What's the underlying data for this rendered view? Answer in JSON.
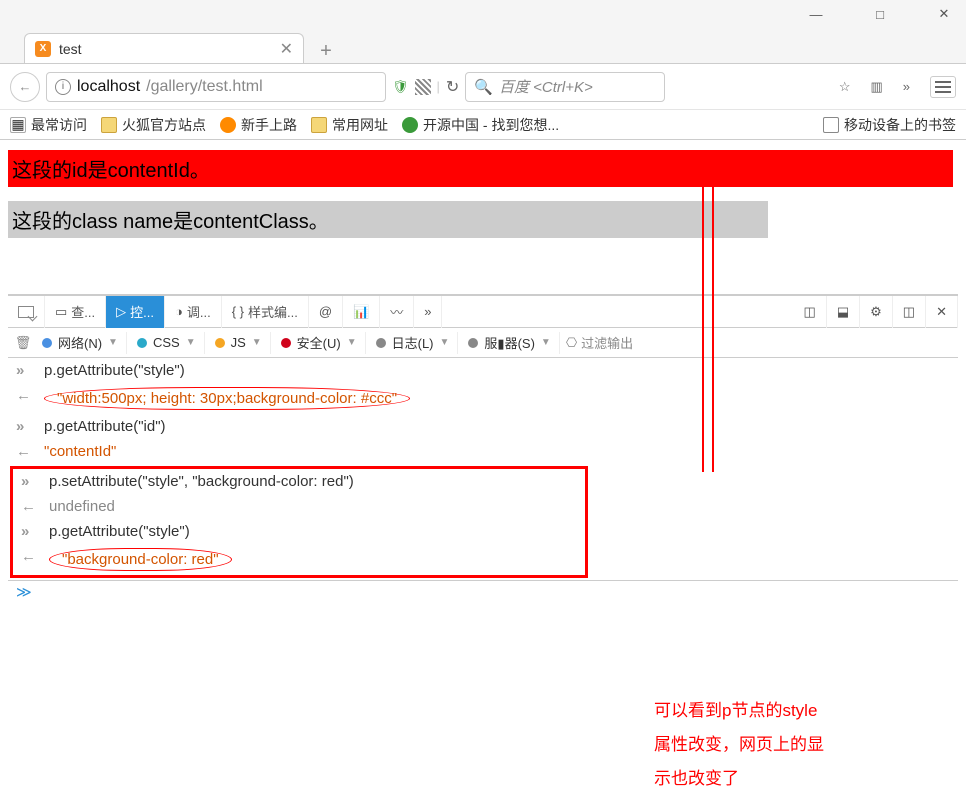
{
  "window": {
    "minimize": "—",
    "maximize": "□",
    "close": "✕"
  },
  "tab": {
    "icon_text": "X",
    "title": "test",
    "close": "✕",
    "newtab": "+"
  },
  "addr": {
    "back": "←",
    "info": "i",
    "host": "localhost",
    "path": "/gallery/test.html",
    "shield": "🛡",
    "refresh": "↻",
    "search_icon": "🔍",
    "search_placeholder": "百度 <Ctrl+K>",
    "star": "☆",
    "library": "▥",
    "more": "»"
  },
  "bookmarks": {
    "items": [
      {
        "label": "最常访问",
        "icon": "blue"
      },
      {
        "label": "火狐官方站点",
        "icon": "folder"
      },
      {
        "label": "新手上路",
        "icon": "ff"
      },
      {
        "label": "常用网址",
        "icon": "folder"
      },
      {
        "label": "开源中国 - 找到您想...",
        "icon": "green"
      }
    ],
    "right": {
      "label": "移动设备上的书签",
      "icon": "phone"
    }
  },
  "page": {
    "p1": "这段的id是contentId。",
    "p2": "这段的class name是contentClass。"
  },
  "devtools": {
    "tabs": {
      "inspector": "查...",
      "console": "控...",
      "debugger": "调...",
      "style": "样式编...",
      "at": "@",
      "more": "»"
    },
    "filters": {
      "net": "网络(N)",
      "css": "CSS",
      "js": "JS",
      "sec": "安全(U)",
      "log": "日志(L)",
      "server": "服▮器(S)",
      "filter_placeholder": "过滤输出"
    },
    "lines": [
      {
        "t": "in",
        "text": "p.getAttribute(\"style\")"
      },
      {
        "t": "out",
        "text": "\"width:500px; height: 30px;background-color: #ccc\"",
        "cls": "strlit",
        "ellipse": true
      },
      {
        "t": "in",
        "text": "p.getAttribute(\"id\")"
      },
      {
        "t": "out",
        "text": "\"contentId\"",
        "cls": "strlit"
      },
      {
        "t": "in",
        "text": "p.setAttribute(\"style\", \"background-color: red\")",
        "box": "start"
      },
      {
        "t": "out",
        "text": "undefined",
        "cls": "undef"
      },
      {
        "t": "in",
        "text": "p.getAttribute(\"style\")"
      },
      {
        "t": "out",
        "text": "\"background-color: red\"",
        "cls": "strlit",
        "ellipse": true,
        "box": "end"
      }
    ],
    "prompt": "≫"
  },
  "annotation": "可以看到p节点的style\n属性改变，网页上的显\n示也改变了"
}
